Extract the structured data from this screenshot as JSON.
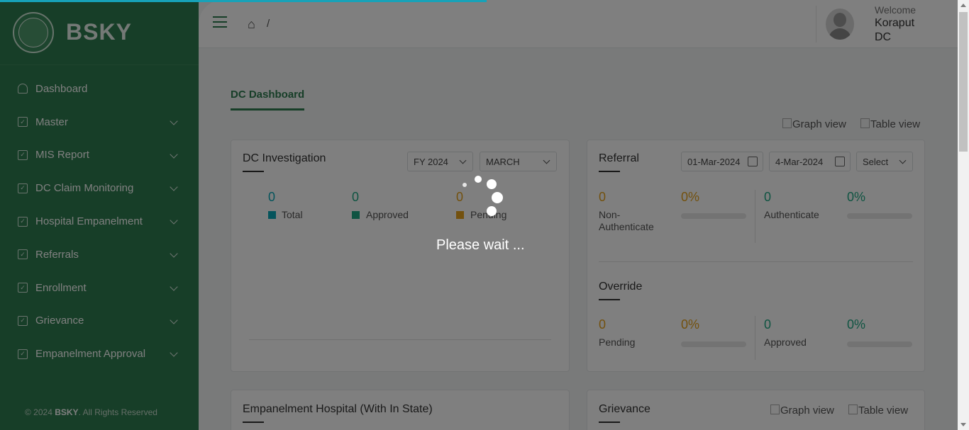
{
  "brand": {
    "name": "BSKY"
  },
  "sidebar": {
    "items": [
      {
        "label": "Dashboard",
        "icon": "dashboard-icon"
      },
      {
        "label": "Master",
        "icon": "checkbox-icon"
      },
      {
        "label": "MIS Report",
        "icon": "checkbox-icon"
      },
      {
        "label": "DC Claim Monitoring",
        "icon": "checkbox-icon"
      },
      {
        "label": "Hospital Empanelment",
        "icon": "checkbox-icon"
      },
      {
        "label": "Referrals",
        "icon": "checkbox-icon"
      },
      {
        "label": "Enrollment",
        "icon": "checkbox-icon"
      },
      {
        "label": "Grievance",
        "icon": "checkbox-icon"
      },
      {
        "label": "Empanelment Approval",
        "icon": "checkbox-icon"
      }
    ],
    "footer_prefix": "© 2024",
    "footer_brand": "BSKY",
    "footer_suffix": ". All Rights Reserved"
  },
  "header": {
    "breadcrumb_sep": "/",
    "welcome": "Welcome",
    "user": "Koraput DC"
  },
  "tabs": {
    "active": "DC Dashboard"
  },
  "views": {
    "graph": "Graph view",
    "table": "Table view"
  },
  "investigation": {
    "title": "DC Investigation",
    "fy": "FY 2024",
    "month": "MARCH",
    "stats": [
      {
        "value": "0",
        "label": "Total",
        "color": "#0aa8b8"
      },
      {
        "value": "0",
        "label": "Approved",
        "color": "#1fa985"
      },
      {
        "value": "0",
        "label": "Pending",
        "color": "#e6a21c"
      }
    ]
  },
  "referral": {
    "title": "Referral",
    "from": "01-Mar-2024",
    "to": "4-Mar-2024",
    "select": "Select",
    "non_auth_value": "0",
    "non_auth_pct": "0%",
    "non_auth_label": "Non-Authenticate",
    "auth_value": "0",
    "auth_pct": "0%",
    "auth_label": "Authenticate"
  },
  "override": {
    "title": "Override",
    "pending_value": "0",
    "pending_pct": "0%",
    "pending_label": "Pending",
    "approved_value": "0",
    "approved_pct": "0%",
    "approved_label": "Approved"
  },
  "empanelment": {
    "title": "Empanelment Hospital (With In State)"
  },
  "grievance": {
    "title": "Grievance"
  },
  "loader": {
    "text": "Please wait ..."
  },
  "colors": {
    "brand": "#2e7d50",
    "orange": "#e6a21c",
    "teal": "#1fa985",
    "cyan": "#0aa8b8"
  }
}
